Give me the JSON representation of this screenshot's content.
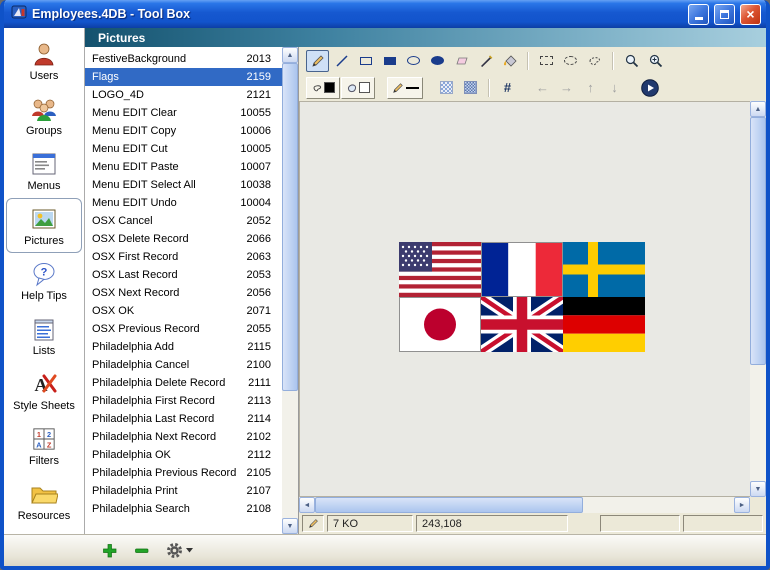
{
  "window": {
    "title": "Employees.4DB - Tool Box"
  },
  "sidebar": {
    "items": [
      {
        "label": "Users",
        "icon": "users-icon",
        "selected": false
      },
      {
        "label": "Groups",
        "icon": "groups-icon",
        "selected": false
      },
      {
        "label": "Menus",
        "icon": "menus-icon",
        "selected": false
      },
      {
        "label": "Pictures",
        "icon": "pictures-icon",
        "selected": true
      },
      {
        "label": "Help Tips",
        "icon": "help-tips-icon",
        "selected": false
      },
      {
        "label": "Lists",
        "icon": "lists-icon",
        "selected": false
      },
      {
        "label": "Style Sheets",
        "icon": "style-sheets-icon",
        "selected": false
      },
      {
        "label": "Filters",
        "icon": "filters-icon",
        "selected": false
      },
      {
        "label": "Resources",
        "icon": "resources-icon",
        "selected": false
      }
    ]
  },
  "header": {
    "title": "Pictures"
  },
  "pictures": {
    "items": [
      {
        "name": "FestiveBackground",
        "id": "2013",
        "selected": false
      },
      {
        "name": "Flags",
        "id": "2159",
        "selected": true
      },
      {
        "name": "LOGO_4D",
        "id": "2121",
        "selected": false
      },
      {
        "name": "Menu EDIT Clear",
        "id": "10055",
        "selected": false
      },
      {
        "name": "Menu EDIT Copy",
        "id": "10006",
        "selected": false
      },
      {
        "name": "Menu EDIT Cut",
        "id": "10005",
        "selected": false
      },
      {
        "name": "Menu EDIT Paste",
        "id": "10007",
        "selected": false
      },
      {
        "name": "Menu EDIT Select All",
        "id": "10038",
        "selected": false
      },
      {
        "name": "Menu EDIT Undo",
        "id": "10004",
        "selected": false
      },
      {
        "name": "OSX Cancel",
        "id": "2052",
        "selected": false
      },
      {
        "name": "OSX Delete Record",
        "id": "2066",
        "selected": false
      },
      {
        "name": "OSX First Record",
        "id": "2063",
        "selected": false
      },
      {
        "name": "OSX Last Record",
        "id": "2053",
        "selected": false
      },
      {
        "name": "OSX Next Record",
        "id": "2056",
        "selected": false
      },
      {
        "name": "OSX OK",
        "id": "2071",
        "selected": false
      },
      {
        "name": "OSX Previous Record",
        "id": "2055",
        "selected": false
      },
      {
        "name": "Philadelphia Add",
        "id": "2115",
        "selected": false
      },
      {
        "name": "Philadelphia Cancel",
        "id": "2100",
        "selected": false
      },
      {
        "name": "Philadelphia Delete Record",
        "id": "2111",
        "selected": false
      },
      {
        "name": "Philadelphia First Record",
        "id": "2113",
        "selected": false
      },
      {
        "name": "Philadelphia Last Record",
        "id": "2114",
        "selected": false
      },
      {
        "name": "Philadelphia Next Record",
        "id": "2102",
        "selected": false
      },
      {
        "name": "Philadelphia OK",
        "id": "2112",
        "selected": false
      },
      {
        "name": "Philadelphia Previous Record",
        "id": "2105",
        "selected": false
      },
      {
        "name": "Philadelphia Print",
        "id": "2107",
        "selected": false
      },
      {
        "name": "Philadelphia Search",
        "id": "2108",
        "selected": false
      }
    ]
  },
  "editor": {
    "tools_row1": [
      "pencil-tool",
      "line-tool",
      "rectangle-tool",
      "filled-rectangle-tool",
      "ellipse-tool",
      "filled-ellipse-tool",
      "eraser-tool",
      "pen-tool",
      "paint-bucket-tool",
      "marquee-select-tool",
      "ellipse-select-tool",
      "lasso-select-tool",
      "zoom-out-tool",
      "zoom-in-tool"
    ],
    "active_tool": "pencil-tool",
    "tools_row2": [
      "foreground-color-picker",
      "background-color-picker",
      "line-width-picker",
      "pattern-light",
      "pattern-dark",
      "grid-toggle",
      "nudge-left",
      "nudge-right",
      "nudge-up",
      "nudge-down",
      "preview-button"
    ],
    "status": {
      "size": "7 KO",
      "position": "243,108"
    },
    "picture_content": "flags-of-usa-france-sweden-japan-uk-germany"
  },
  "footer": {
    "buttons": [
      "add-picture",
      "delete-picture",
      "options-gear"
    ]
  },
  "colors": {
    "selection": "#316AC5",
    "titlebar_blue": "#1658D0",
    "header_dark": "#14526E",
    "header_light": "#A8CFDE",
    "toolbox_bg": "#ECE9D8"
  }
}
